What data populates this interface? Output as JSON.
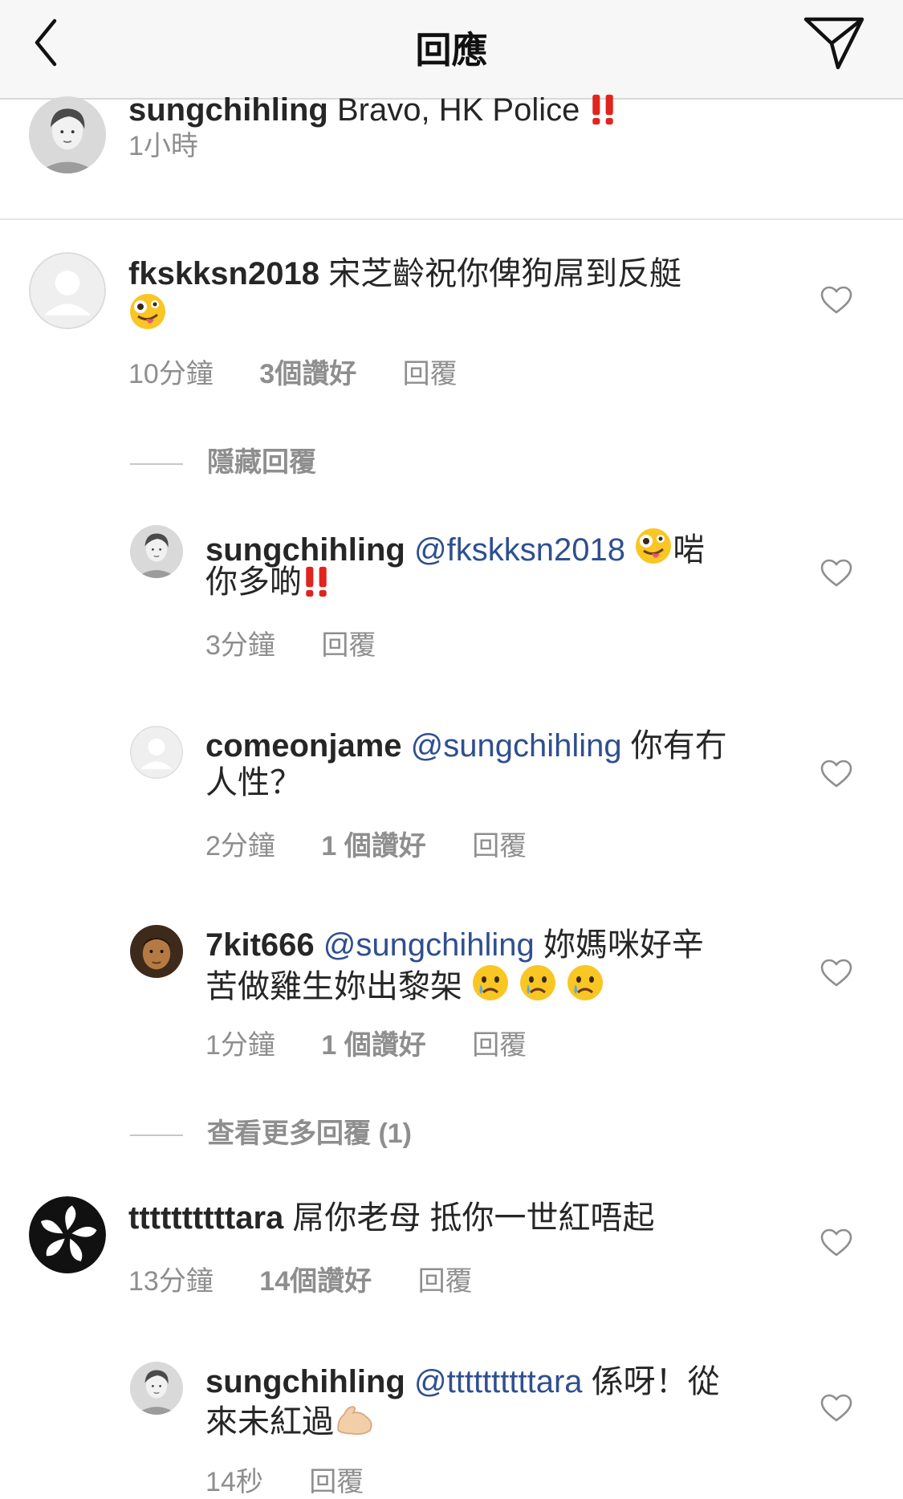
{
  "header": {
    "title": "回應"
  },
  "caption": {
    "username": "sungchihling",
    "text": "Bravo, HK Police",
    "time": "1小時"
  },
  "comments": [
    {
      "username": "fkskksn2018",
      "text_line1": "宋芝齡祝你俾狗屌到反艇",
      "time": "10分鐘",
      "likes": "3個讚好",
      "reply": "回覆"
    },
    {
      "username": "ttttttttttara",
      "text": "屌你老母 抵你一世紅唔起",
      "time": "13分鐘",
      "likes": "14個讚好",
      "reply": "回覆"
    }
  ],
  "hide_replies": "隱藏回覆",
  "view_more": "查看更多回覆 (1)",
  "replies": [
    {
      "username": "sungchihling",
      "mention": "@fkskksn2018",
      "text_after_emoji": "啱",
      "text_line2": "你多啲",
      "time": "3分鐘",
      "reply": "回覆"
    },
    {
      "username": "comeonjame",
      "mention": "@sungchihling",
      "text_line1": "你有冇",
      "text_line2": "人性？",
      "time": "2分鐘",
      "likes": "1 個讚好",
      "reply": "回覆"
    },
    {
      "username": "7kit666",
      "mention": "@sungchihling",
      "text_line1": "妳媽咪好辛",
      "text_line2": "苦做雞生妳出黎架",
      "time": "1分鐘",
      "likes": "1 個讚好",
      "reply": "回覆"
    },
    {
      "username": "sungchihling",
      "mention": "@ttttttttttara",
      "text_line1": "係呀！從",
      "text_line2": "來未紅過",
      "time": "14秒",
      "reply": "回覆"
    }
  ],
  "icons": {
    "back": "chevron-left-icon",
    "send": "paper-plane-icon",
    "heart": "heart-outline-icon",
    "emoji_zany": "zany-face",
    "emoji_bang": "double-exclamation",
    "emoji_cry": "crying-face",
    "emoji_muscle": "flexed-biceps"
  },
  "colors": {
    "mention": "#2f4f8f",
    "meta": "#8e8e8e",
    "exclamation": "#e0241e"
  }
}
